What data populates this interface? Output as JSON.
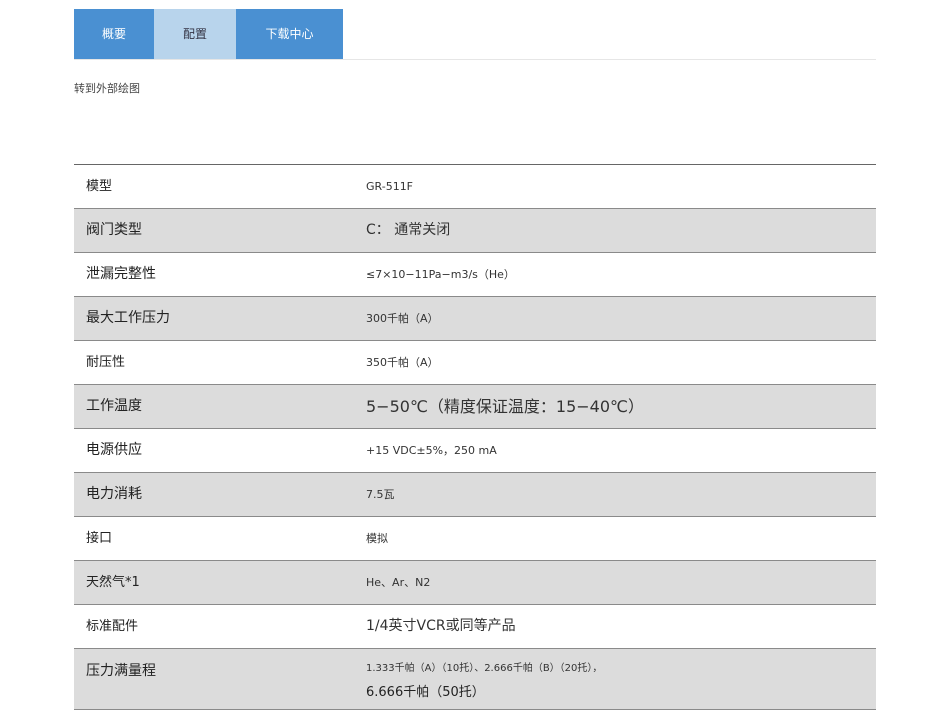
{
  "tabs": [
    {
      "label": "概要"
    },
    {
      "label": "配置"
    },
    {
      "label": "下载中心"
    }
  ],
  "link_text": "转到外部绘图",
  "specs": [
    {
      "label": "模型",
      "value": "GR-511F"
    },
    {
      "label": "阀门类型",
      "value": "C： 通常关闭"
    },
    {
      "label": "泄漏完整性",
      "value": "≤7×10−11Pa−m3/s（He）"
    },
    {
      "label": "最大工作压力",
      "value": "300千帕（A）"
    },
    {
      "label": "耐压性",
      "value": "350千帕（A）"
    },
    {
      "label": "工作温度",
      "value": "5−50℃（精度保证温度：15−40℃）"
    },
    {
      "label": "电源供应",
      "value": "+15 VDC±5%，250 mA"
    },
    {
      "label": "电力消耗",
      "value": "7.5瓦"
    },
    {
      "label": "接口",
      "value": "模拟"
    },
    {
      "label": "天然气*1",
      "value": "He、Ar、N2"
    },
    {
      "label": "标准配件",
      "value": "1/4英寸VCR或同等产品"
    },
    {
      "label": "压力满量程",
      "value_line1": "1.333千帕（A）（10托）、2.666千帕（B）（20托），",
      "value_line2": "6.666千帕（50托）"
    }
  ]
}
